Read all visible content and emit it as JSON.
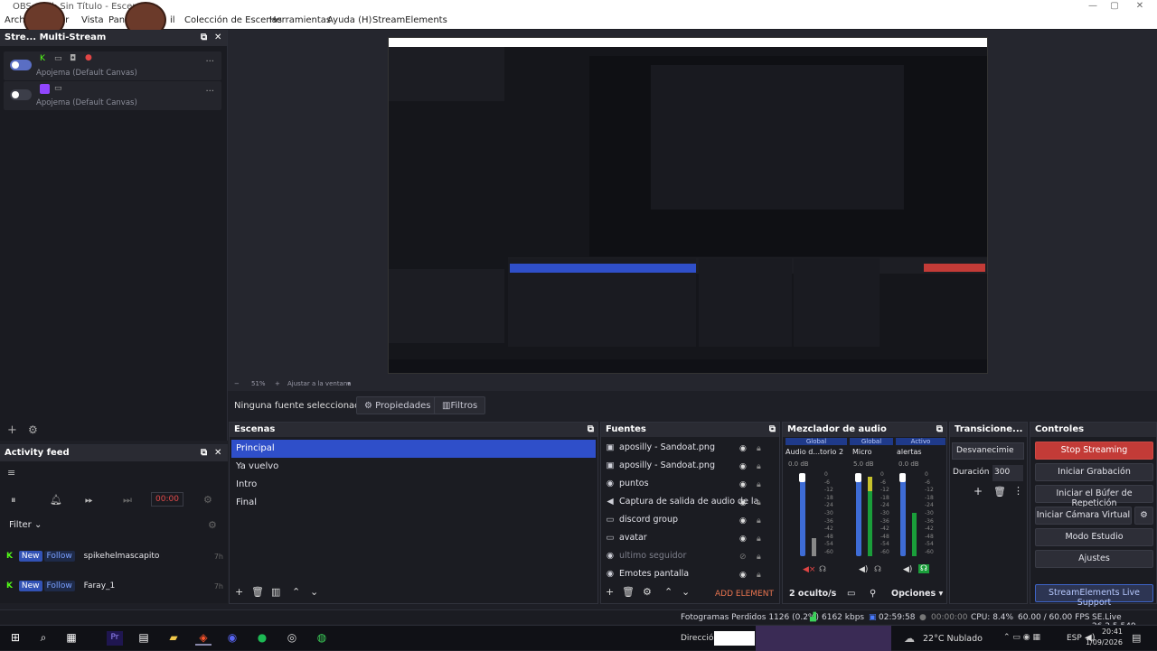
{
  "window": {
    "title": "OBS ... fil: Sin Título - Escen...",
    "controls": [
      "—",
      "▢",
      "✕"
    ]
  },
  "menu": [
    "Archi",
    "ar",
    "Vista",
    "Pan",
    "il",
    "Colección de Escenas",
    "Herramientas",
    "Ayuda (H)",
    "StreamElements"
  ],
  "multistream": {
    "header": "Stre... Multi-Stream",
    "rows": [
      {
        "canvas": "Apojema (Default Canvas)",
        "on": true
      },
      {
        "canvas": "Apojema (Default Canvas)",
        "on": false
      }
    ],
    "more": "···"
  },
  "preview": {
    "zoom": "51%",
    "fit": "Ajustar a la ventana"
  },
  "properties_bar": {
    "no_source": "Ninguna fuente seleccionad",
    "properties": "Propiedades",
    "filters": "Filtros"
  },
  "activity": {
    "header": "Activity feed",
    "filter": "Filter",
    "timer": "00:00",
    "events": [
      {
        "badge_new": "New",
        "badge_type": "Follow",
        "name": "spikehelmascapito",
        "time": "7h"
      },
      {
        "badge_new": "New",
        "badge_type": "Follow",
        "name": "Faray_1",
        "time": "7h"
      }
    ]
  },
  "scenes": {
    "header": "Escenas",
    "items": [
      "Principal",
      "Ya vuelvo",
      "Intro",
      "Final"
    ],
    "selected": 0
  },
  "sources": {
    "header": "Fuentes",
    "items": [
      {
        "icon": "▣",
        "name": "aposilly - Sandoat.png",
        "hidden": false
      },
      {
        "icon": "▣",
        "name": "aposilly - Sandoat.png",
        "hidden": false
      },
      {
        "icon": "◉",
        "name": "puntos",
        "hidden": false
      },
      {
        "icon": "◀",
        "name": "Captura de salida de audio de la",
        "hidden": false
      },
      {
        "icon": "▭",
        "name": "discord group",
        "hidden": false
      },
      {
        "icon": "▭",
        "name": "avatar",
        "hidden": false
      },
      {
        "icon": "◉",
        "name": "ultimo seguidor",
        "hidden": true
      },
      {
        "icon": "◉",
        "name": "Emotes pantalla",
        "hidden": false
      }
    ],
    "add_element": "ADD ELEMENT"
  },
  "mixer": {
    "header": "Mezclador de audio",
    "channels": [
      {
        "tag": "Global",
        "name": "Audio d...torio 2",
        "db": "0.0 dB"
      },
      {
        "tag": "Global",
        "name": "Micro",
        "db": "5.0 dB"
      },
      {
        "tag": "Activo",
        "name": "alertas",
        "db": "0.0 dB"
      }
    ],
    "scale": [
      "0",
      "-6",
      "-12",
      "-18",
      "-24",
      "-30",
      "-36",
      "-42",
      "-48",
      "-54",
      "-60"
    ],
    "hidden": "2 oculto/s",
    "options": "Opciones"
  },
  "transitions": {
    "header": "Transicione...",
    "type": "Desvanecimie",
    "duration_label": "Duración",
    "duration": "300"
  },
  "controls": {
    "header": "Controles",
    "stop_streaming": "Stop Streaming",
    "start_recording": "Iniciar Grabación",
    "start_replay": "Iniciar el Búfer de Repetición",
    "start_vcam": "Iniciar Cámara Virtual",
    "studio_mode": "Modo Estudio",
    "settings": "Ajustes",
    "se_support": "StreamElements Live Support"
  },
  "status": {
    "dropped": "Fotogramas Perdidos 1126 (0.2%)",
    "kbps": "6162 kbps",
    "live_time": "02:59:58",
    "rec_time": "00:00:00",
    "cpu": "CPU: 8.4%",
    "fps": "60.00 / 60.00 FPS",
    "se_version": "SE.Live 26.2.5.549"
  },
  "taskbar": {
    "address_label": "Dirección",
    "weather": "22°C  Nublado",
    "lang": "ESP",
    "time": "20:41",
    "date": "1/09/2026"
  },
  "colors": {
    "selected": "#2f4fc9",
    "stop": "#c33b37",
    "accent": "#3d64c8"
  }
}
